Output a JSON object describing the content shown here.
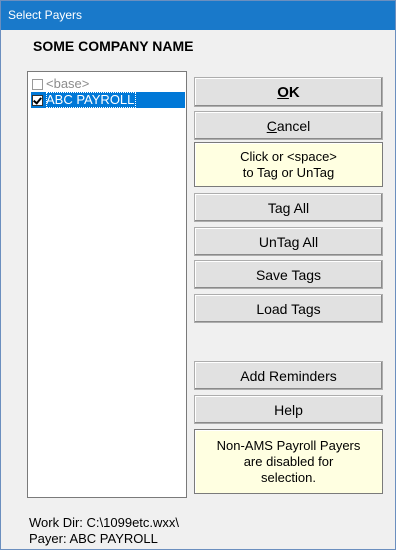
{
  "window": {
    "title": "Select Payers"
  },
  "company_name": "SOME COMPANY NAME",
  "payers_list": [
    {
      "label": "<base>",
      "checked": false,
      "selected": false
    },
    {
      "label": "ABC PAYROLL",
      "checked": true,
      "selected": true
    }
  ],
  "buttons": {
    "ok": {
      "accel": "O",
      "rest": "K"
    },
    "cancel": {
      "accel": "C",
      "rest": "ancel"
    },
    "tag_all": "Tag All",
    "untag_all": "UnTag All",
    "save_tags": "Save Tags",
    "load_tags": "Load Tags",
    "add_reminders": "Add Reminders",
    "help": "Help"
  },
  "notes": {
    "tag_tip": [
      "Click or <space>",
      "to Tag or UnTag"
    ],
    "disabled_note": [
      "Non-AMS Payroll Payers",
      "are disabled for",
      "selection."
    ]
  },
  "footer": {
    "work_dir": "Work Dir: C:\\1099etc.wxx\\",
    "payer": "Payer: ABC PAYROLL"
  },
  "colors": {
    "titlebar": "#1979ca",
    "selection": "#0078d7",
    "note_background": "#ffffe1"
  }
}
